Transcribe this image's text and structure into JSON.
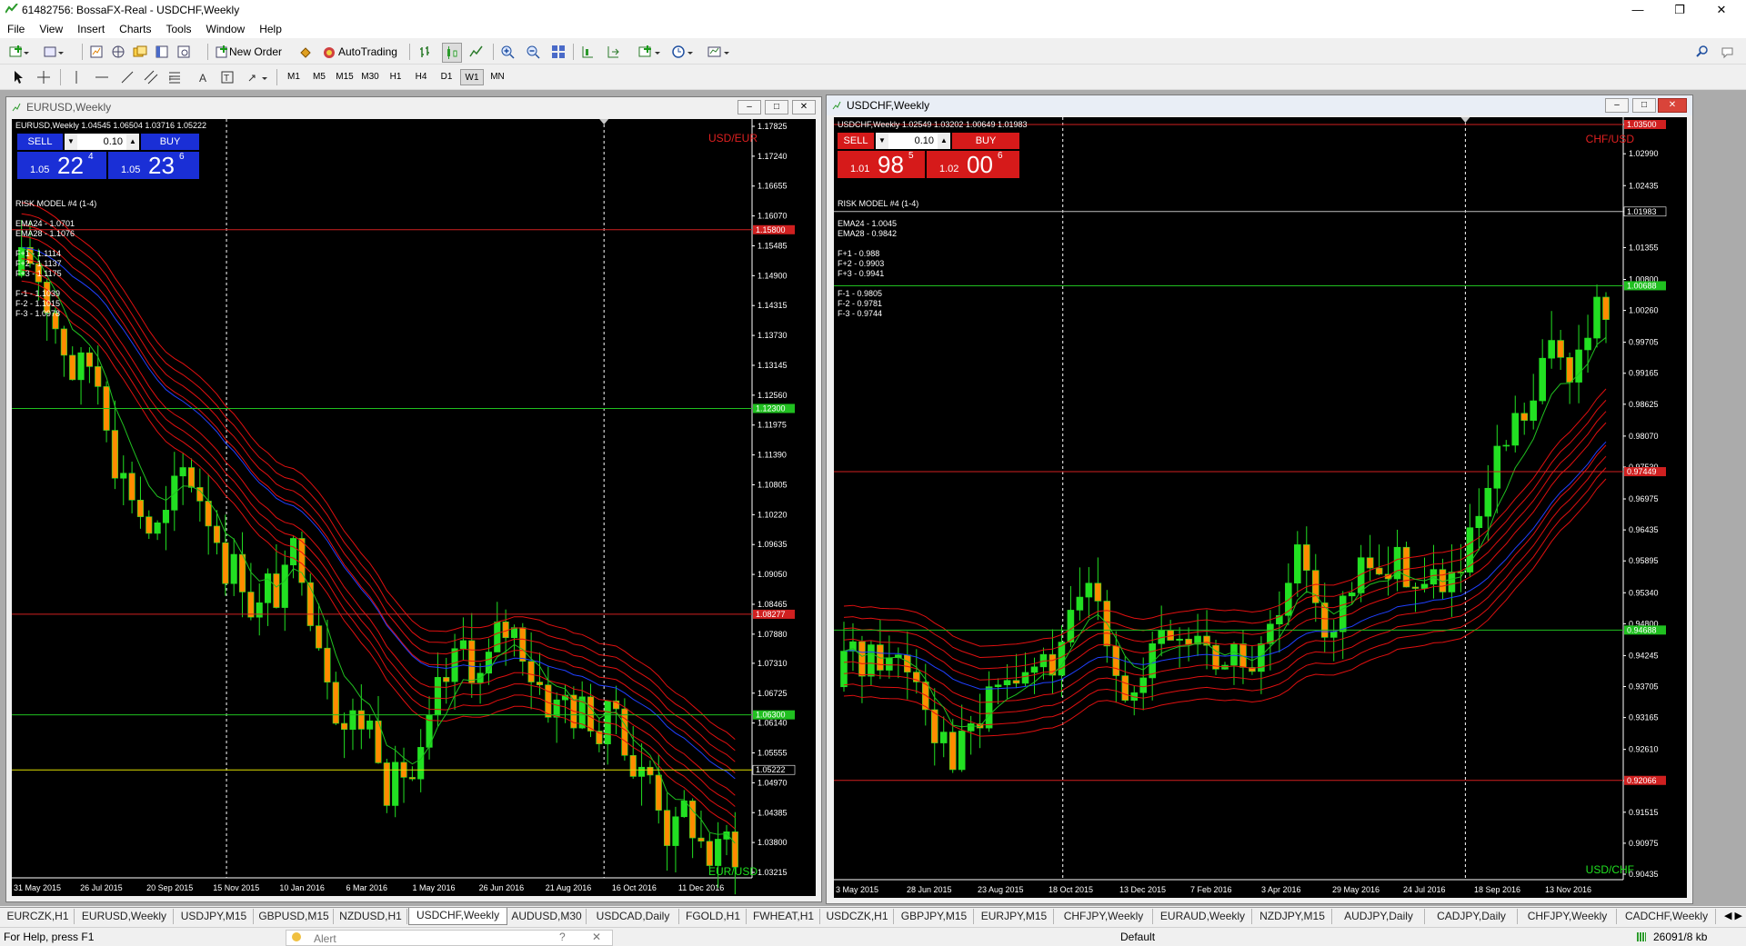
{
  "window": {
    "title": "61482756: BossaFX-Real - USDCHF,Weekly"
  },
  "menu": [
    "File",
    "View",
    "Insert",
    "Charts",
    "Tools",
    "Window",
    "Help"
  ],
  "toolbar": {
    "new_order": "New Order",
    "auto_trading": "AutoTrading"
  },
  "timeframes": [
    "M1",
    "M5",
    "M15",
    "M30",
    "H1",
    "H4",
    "D1",
    "W1",
    "MN"
  ],
  "active_timeframe": "W1",
  "icons": [
    "new-chart-icon",
    "profiles-icon",
    "market-watch-icon",
    "navigator-icon",
    "data-window-icon",
    "terminal-icon",
    "strategy-tester-icon",
    "new-order-icon",
    "autotrading-icon",
    "bar-chart-icon",
    "candlestick-icon",
    "line-chart-icon",
    "zoom-in-icon",
    "zoom-out-icon",
    "tile-windows-icon",
    "chart-shift-icon",
    "autoscroll-icon",
    "indicators-icon",
    "periods-icon",
    "templates-icon",
    "search-icon",
    "cursor-icon",
    "crosshair-icon",
    "vertical-line-icon",
    "horizontal-line-icon",
    "trendline-icon",
    "equidistant-channel-icon",
    "fibonacci-icon",
    "text-icon",
    "text-label-icon",
    "arrows-icon"
  ],
  "charts": [
    {
      "window_title": "EURUSD,Weekly",
      "header": "EURUSD,Weekly  1.04545 1.06504 1.03716 1.05222",
      "sell_label": "SELL",
      "buy_label": "BUY",
      "lot": "0.10",
      "sell_price": {
        "small": "1.05",
        "big": "22",
        "sup": "4"
      },
      "buy_price": {
        "small": "1.05",
        "big": "23",
        "sup": "6"
      },
      "panel_color": "#1a2fd6",
      "indicator_lines": [
        "RISK MODEL #4 (1-4)",
        "",
        "EMA24 - 1.0701",
        "EMA28 - 1.1076",
        "",
        "F+1 - 1.1114",
        "F+2 - 1.1137",
        "F+3 - 1.1175",
        "",
        "F-1 - 1.1039",
        "F-2 - 1.1015",
        "F-3 - 1.0978"
      ],
      "pair_top": "USD/EUR",
      "pair_top_color": "#e02020",
      "pair_bottom": "EUR/USD",
      "pair_bottom_color": "#20e020",
      "price_labels": [
        "1.17825",
        "1.17240",
        "1.16655",
        "1.16070",
        "1.15485",
        "1.14900",
        "1.14315",
        "1.13730",
        "1.13145",
        "1.12560",
        "1.11975",
        "1.11390",
        "1.10805",
        "1.10220",
        "1.09635",
        "1.09050",
        "1.08465",
        "1.07880",
        "1.07310",
        "1.06725",
        "1.06140",
        "1.05555",
        "1.04970",
        "1.04385",
        "1.03800",
        "1.03215"
      ],
      "date_labels": [
        "31 May 2015",
        "26 Jul 2015",
        "20 Sep 2015",
        "15 Nov 2015",
        "10 Jan 2016",
        "6 Mar 2016",
        "1 May 2016",
        "26 Jun 2016",
        "21 Aug 2016",
        "16 Oct 2016",
        "11 Dec 2016"
      ],
      "hlines": [
        {
          "price": 1.158,
          "color": "#d02020",
          "label": "1.15800"
        },
        {
          "price": 1.123,
          "color": "#20c020",
          "label": "1.12300"
        },
        {
          "price": 1.0827,
          "color": "#d02020",
          "label": "1.08277"
        },
        {
          "price": 1.063,
          "color": "#20c020",
          "label": "1.06300"
        },
        {
          "price": 1.05222,
          "color": "#e0e000",
          "label": "1.05222",
          "current": true
        }
      ]
    },
    {
      "window_title": "USDCHF,Weekly",
      "header": "USDCHF,Weekly  1.02549 1.03202 1.00649 1.01983",
      "sell_label": "SELL",
      "buy_label": "BUY",
      "lot": "0.10",
      "sell_price": {
        "small": "1.01",
        "big": "98",
        "sup": "5"
      },
      "buy_price": {
        "small": "1.02",
        "big": "00",
        "sup": "6"
      },
      "panel_color": "#d61a1a",
      "indicator_lines": [
        "RISK MODEL #4 (1-4)",
        "",
        "EMA24 - 1.0045",
        "EMA28 - 0.9842",
        "",
        "F+1 - 0.988",
        "F+2 - 0.9903",
        "F+3 - 0.9941",
        "",
        "F-1 - 0.9805",
        "F-2 - 0.9781",
        "F-3 - 0.9744"
      ],
      "pair_top": "CHF/USD",
      "pair_top_color": "#e02020",
      "pair_bottom": "USD/CHF",
      "pair_bottom_color": "#20e020",
      "price_labels": [
        "1.03500",
        "1.02990",
        "1.02435",
        "1.01983",
        "1.01355",
        "1.00800",
        "1.00260",
        "0.99705",
        "0.99165",
        "0.98625",
        "0.98070",
        "0.97530",
        "0.96975",
        "0.96435",
        "0.95895",
        "0.95340",
        "0.94800",
        "0.94245",
        "0.93705",
        "0.93165",
        "0.92610",
        "0.92066",
        "0.91515",
        "0.90975",
        "0.90435"
      ],
      "date_labels": [
        "3 May 2015",
        "28 Jun 2015",
        "23 Aug 2015",
        "18 Oct 2015",
        "13 Dec 2015",
        "7 Feb 2016",
        "3 Apr 2016",
        "29 May 2016",
        "24 Jul 2016",
        "18 Sep 2016",
        "13 Nov 2016"
      ],
      "hlines": [
        {
          "price": 1.035,
          "color": "#d02020",
          "label": "1.03500"
        },
        {
          "price": 1.01983,
          "color": "#c0c0c0",
          "label": "1.01983",
          "current": true
        },
        {
          "price": 1.0069,
          "color": "#20c020",
          "label": "1.00688"
        },
        {
          "price": 0.9745,
          "color": "#d02020",
          "label": "0.97449"
        },
        {
          "price": 0.9469,
          "color": "#20c020",
          "label": "0.94688"
        },
        {
          "price": 0.9207,
          "color": "#d02020",
          "label": "0.92066"
        }
      ]
    }
  ],
  "tabs": [
    "EURCZK,H1",
    "EURUSD,Weekly",
    "USDJPY,M15",
    "GBPUSD,M15",
    "NZDUSD,H1",
    "USDCHF,Weekly",
    "AUDUSD,M30",
    "USDCAD,Daily",
    "FGOLD,H1",
    "FWHEAT,H1",
    "USDCZK,H1",
    "GBPJPY,M15",
    "EURJPY,M15",
    "CHFJPY,Weekly",
    "EURAUD,Weekly",
    "NZDJPY,M15",
    "AUDJPY,Daily",
    "CADJPY,Daily",
    "CHFJPY,Weekly",
    "CADCHF,Weekly"
  ],
  "active_tab": "USDCHF,Weekly",
  "status": {
    "help": "For Help, press F1",
    "alert": "Alert",
    "profile": "Default",
    "traffic": "26091/8 kb"
  }
}
